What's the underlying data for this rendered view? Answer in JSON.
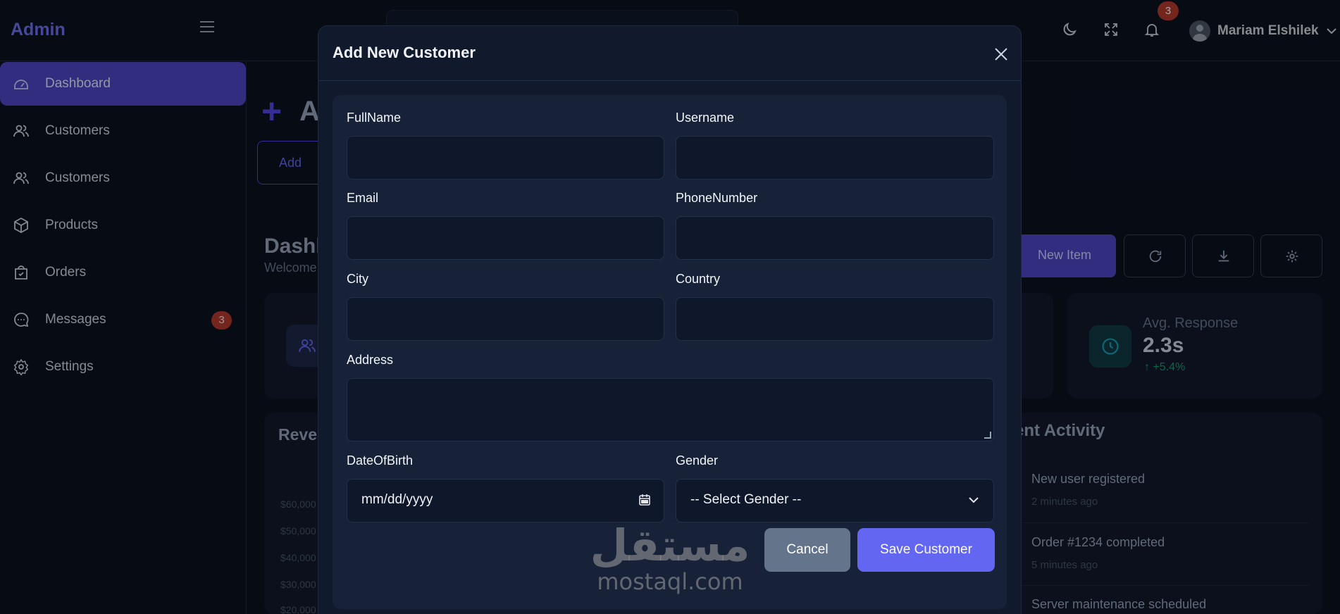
{
  "app": {
    "brand": "Admin",
    "user_name": "Mariam Elshilek",
    "notifications_count": "3"
  },
  "sidebar": {
    "items": [
      {
        "label": "Dashboard",
        "icon": "dashboard-icon",
        "active": true
      },
      {
        "label": "Customers",
        "icon": "users-icon"
      },
      {
        "label": "Customers",
        "icon": "users-icon"
      },
      {
        "label": "Products",
        "icon": "box-icon"
      },
      {
        "label": "Orders",
        "icon": "shopping-bag-icon"
      },
      {
        "label": "Messages",
        "icon": "chat-icon",
        "badge": "3"
      },
      {
        "label": "Settings",
        "icon": "gear-icon"
      }
    ]
  },
  "background": {
    "page_heading_partial": "A",
    "add_button_partial": "Add",
    "dashboard_title_partial": "Dashl",
    "dashboard_subtitle_partial": "Welcome",
    "new_item_label": "New Item",
    "stat": {
      "label": "Avg. Response",
      "value": "2.3s",
      "change": "+5.4%"
    },
    "revenue_title_partial": "Rever",
    "y_ticks": [
      "$60,000",
      "$50,000",
      "$40,000",
      "$30,000",
      "$20,000"
    ],
    "activity_title_partial": "ent Activity",
    "activity": [
      {
        "text": "New user registered",
        "time": "2 minutes ago"
      },
      {
        "text": "Order #1234 completed",
        "time": "5 minutes ago"
      },
      {
        "text": "Server maintenance scheduled",
        "time": ""
      }
    ]
  },
  "modal": {
    "title": "Add New Customer",
    "fields": {
      "fullname_label": "FullName",
      "username_label": "Username",
      "email_label": "Email",
      "phone_label": "PhoneNumber",
      "city_label": "City",
      "country_label": "Country",
      "address_label": "Address",
      "dob_label": "DateOfBirth",
      "dob_value": "mm/dd/yyyy",
      "gender_label": "Gender",
      "gender_value": "-- Select Gender --"
    },
    "cancel_label": "Cancel",
    "save_label": "Save Customer"
  },
  "watermark": {
    "arabic": "مستقل",
    "latin": "mostaql.com"
  },
  "colors": {
    "accent": "#6366f1",
    "sidebar_active": "#4f46c5",
    "badge": "#b23a2e",
    "cancel": "#64748b"
  }
}
